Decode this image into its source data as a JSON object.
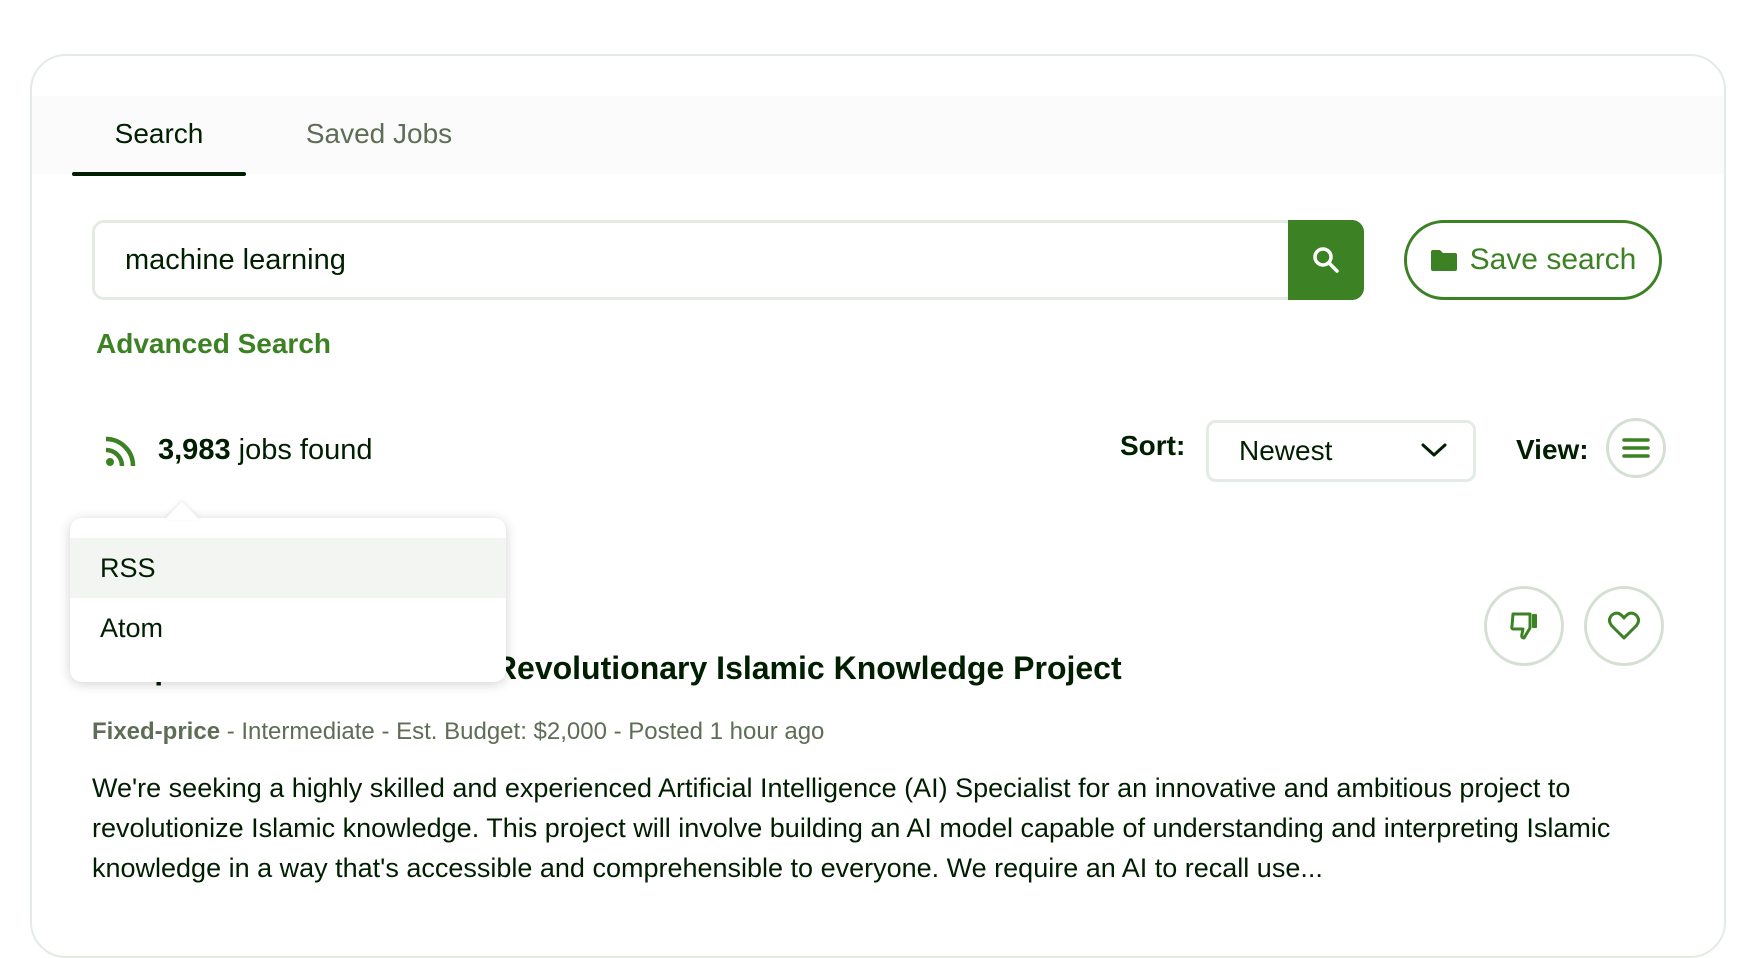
{
  "tabs": [
    {
      "label": "Search",
      "active": true
    },
    {
      "label": "Saved Jobs",
      "active": false
    }
  ],
  "search": {
    "value": "machine learning",
    "save_label": "Save search",
    "advanced_label": "Advanced Search"
  },
  "results": {
    "count": "3,983",
    "count_suffix": " jobs found"
  },
  "sort": {
    "label": "Sort:",
    "value": "Newest"
  },
  "view": {
    "label": "View:"
  },
  "feed_menu": {
    "items": [
      "RSS",
      "Atom"
    ]
  },
  "job": {
    "title": "AI Specialist Needed for a Revolutionary Islamic Knowledge Project",
    "type": "Fixed-price",
    "meta": " - Intermediate - Est. Budget: $2,000 - Posted 1 hour ago",
    "description": "We're seeking a highly skilled and experienced Artificial Intelligence (AI) Specialist for an innovative and ambitious project to revolutionize Islamic knowledge. This project will involve building an AI model capable of understanding and interpreting Islamic knowledge in a way that's accessible and comprehensible to everyone. We require an AI to recall use..."
  },
  "colors": {
    "brand": "#3c8224",
    "text": "#001e00",
    "muted": "#5e6d55",
    "border": "#e4ebe4"
  },
  "icons": [
    "search-icon",
    "folder-icon",
    "rss-icon",
    "chevron-down-icon",
    "list-view-icon",
    "thumbs-down-icon",
    "heart-icon"
  ]
}
